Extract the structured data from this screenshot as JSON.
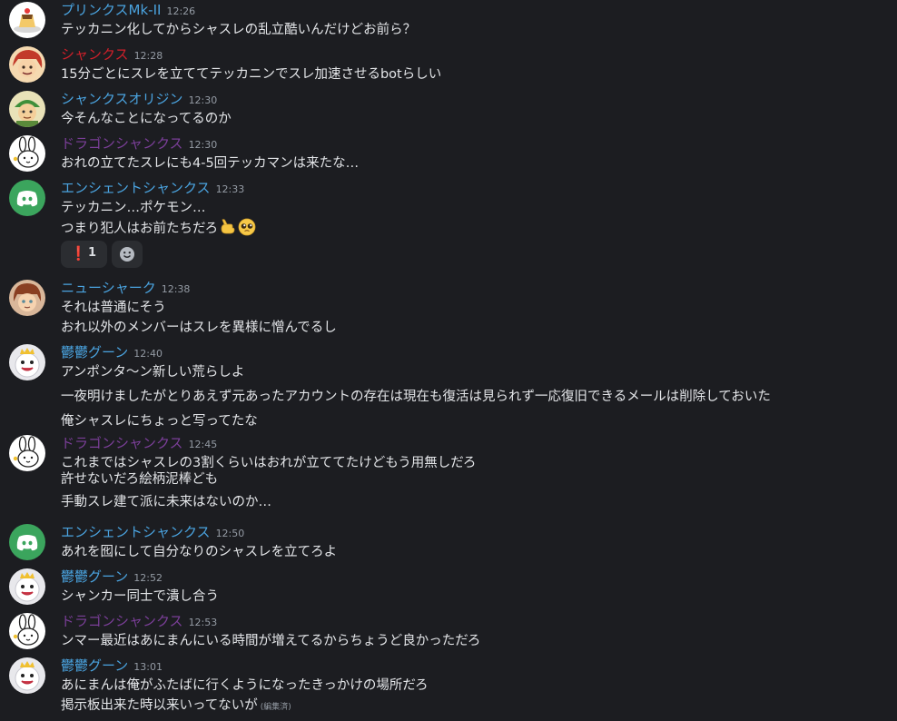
{
  "colors": {
    "background": "#1c1d21",
    "name_blue": "#4aa3df",
    "name_red": "#d0202a",
    "name_purple": "#7b3f99",
    "timestamp": "#949ba4",
    "text": "#e3e5e8",
    "discord_green": "#3ba55d"
  },
  "messages": [
    {
      "author": "プリンクスMk-II",
      "time": "12:26",
      "avatar_icon": "pudding-avatar-icon",
      "lines": [
        "テッカニン化してからシャスレの乱立酷いんだけどお前ら？"
      ]
    },
    {
      "author": "シャンクス",
      "time": "12:28",
      "avatar_icon": "shanks-avatar-icon",
      "lines": [
        "15分ごとにスレを立ててテッカニンでスレ加速させるbotらしい"
      ]
    },
    {
      "author": "シャンクスオリジン",
      "time": "12:30",
      "avatar_icon": "green-cap-character-avatar-icon",
      "lines": [
        "今そんなことになってるのか"
      ]
    },
    {
      "author": "ドラゴンシャンクス",
      "time": "12:30",
      "avatar_icon": "white-rabbit-avatar-icon",
      "lines": [
        "おれの立てたスレにも4-5回テッカマンは来たな…"
      ]
    },
    {
      "author": "エンシェントシャンクス",
      "time": "12:33",
      "avatar_icon": "discord-logo-avatar-icon",
      "lines": [
        "テッカニン…ポケモン…",
        "つまり犯人はお前たちだろ"
      ],
      "emojis": [
        "pointing-hand-emoji",
        "pleading-face-emoji"
      ],
      "reactions": [
        {
          "icon": "exclamation-icon",
          "glyph": "❗",
          "count": "1"
        },
        {
          "icon": "add-reaction-icon",
          "count": ""
        }
      ]
    },
    {
      "author": "ニューシャーク",
      "time": "12:38",
      "avatar_icon": "brown-hair-character-avatar-icon",
      "lines": [
        "それは普通にそう",
        "おれ以外のメンバーはスレを異様に憎んでるし"
      ]
    },
    {
      "author": "鬱鬱グーン",
      "time": "12:40",
      "avatar_icon": "king-boo-avatar-icon",
      "lines": [
        "アンポンタ～ン新しい荒らしよ",
        "一夜明けましたがとりあえず元あったアカウントの存在は現在も復活は見られず一応復旧できるメールは削除しておいた",
        "俺シャスレにちょっと写ってたな"
      ]
    },
    {
      "author": "ドラゴンシャンクス",
      "time": "12:45",
      "avatar_icon": "white-rabbit-avatar-icon",
      "lines": [
        "これまではシャスレの3割くらいはおれが立ててたけどもう用無しだろ",
        "許せないだろ絵柄泥棒ども",
        "手動スレ建て派に未来はないのか…"
      ]
    },
    {
      "author": "エンシェントシャンクス",
      "time": "12:50",
      "avatar_icon": "discord-logo-avatar-icon",
      "lines": [
        "あれを囮にして自分なりのシャスレを立てろよ"
      ]
    },
    {
      "author": "鬱鬱グーン",
      "time": "12:52",
      "avatar_icon": "king-boo-avatar-icon",
      "lines": [
        "シャンカー同士で潰し合う"
      ]
    },
    {
      "author": "ドラゴンシャンクス",
      "time": "12:53",
      "avatar_icon": "white-rabbit-avatar-icon",
      "lines": [
        "ンマー最近はあにまんにいる時間が増えてるからちょうど良かっただろ"
      ]
    },
    {
      "author": "鬱鬱グーン",
      "time": "13:01",
      "avatar_icon": "king-boo-avatar-icon",
      "lines": [
        "あにまんは俺がふたばに行くようになったきっかけの場所だろ",
        "掲示板出来た時以来いってないが"
      ],
      "edited": "(編集済)"
    }
  ]
}
